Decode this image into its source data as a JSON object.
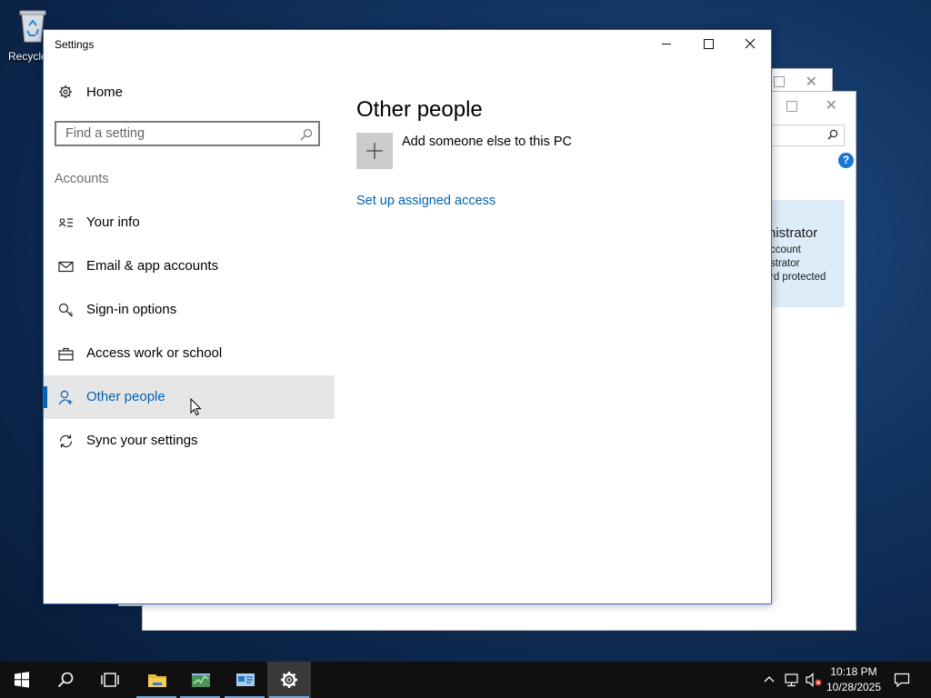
{
  "desktop": {
    "recycle_label": "Recycle"
  },
  "bg_window": {
    "card_title": "nistrator",
    "card_lines": [
      "ccount",
      "strator",
      "rd protected"
    ]
  },
  "window": {
    "title": "Settings"
  },
  "nav": {
    "home_label": "Home",
    "search_placeholder": "Find a setting",
    "section_label": "Accounts",
    "items": [
      {
        "label": "Your info",
        "icon": "contact-card-icon"
      },
      {
        "label": "Email & app accounts",
        "icon": "mail-icon"
      },
      {
        "label": "Sign-in options",
        "icon": "key-icon"
      },
      {
        "label": "Access work or school",
        "icon": "briefcase-icon"
      },
      {
        "label": "Other people",
        "icon": "person-add-icon",
        "active": true
      },
      {
        "label": "Sync your settings",
        "icon": "sync-icon"
      }
    ]
  },
  "content": {
    "title": "Other people",
    "add_label": "Add someone else to this PC",
    "link_label": "Set up assigned access"
  },
  "taskbar": {
    "apps": [
      "file-explorer-icon",
      "task-manager-icon",
      "server-manager-icon",
      "settings-gear-icon"
    ],
    "time": "10:18 PM",
    "date": "10/28/2025"
  },
  "colors": {
    "accent": "#0063b1",
    "active_bg": "#e6e6e6",
    "taskbar": "#101010"
  }
}
